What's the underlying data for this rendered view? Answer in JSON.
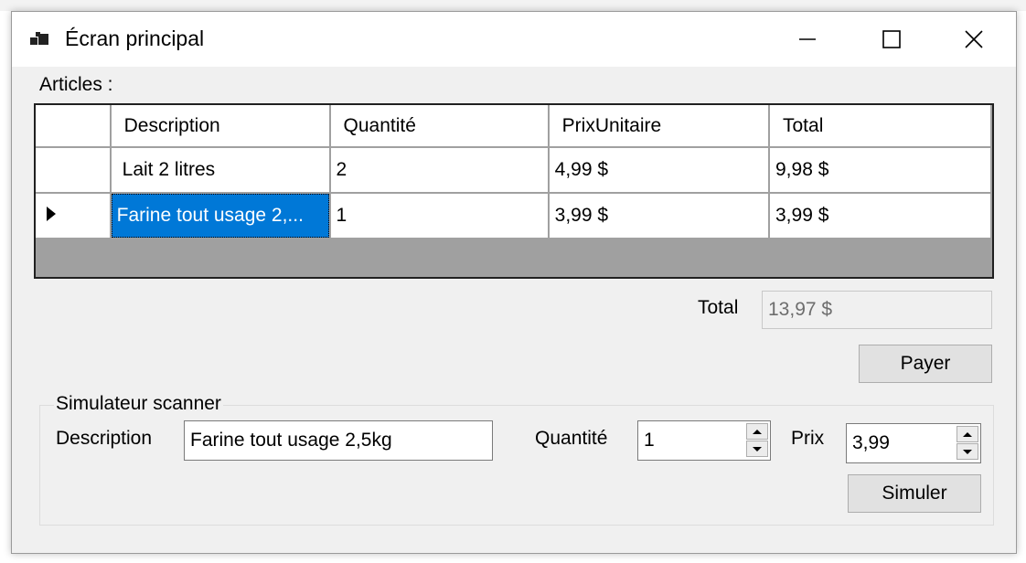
{
  "window": {
    "title": "Écran principal",
    "icons": {
      "app": "app-window-icon",
      "minimize": "minimize-icon",
      "maximize": "maximize-icon",
      "close": "close-icon"
    }
  },
  "articles": {
    "label": "Articles :",
    "columns": [
      "Description",
      "Quantité",
      "PrixUnitaire",
      "Total"
    ],
    "rows": [
      [
        "Lait 2 litres",
        "2",
        "4,99 $",
        "9,98 $"
      ],
      [
        "Farine tout usage 2,...",
        "1",
        "3,99 $",
        "3,99 $"
      ]
    ],
    "selected_row": 1,
    "row_indicator_icon": "row-pointer-icon"
  },
  "total": {
    "label": "Total",
    "value": "13,97 $"
  },
  "payer_button": "Payer",
  "scanner": {
    "title": "Simulateur scanner",
    "description_label": "Description",
    "description_value": "Farine tout usage 2,5kg",
    "quantity_label": "Quantité",
    "quantity_value": "1",
    "price_label": "Prix",
    "price_value": "3,99",
    "simulate_button": "Simuler"
  },
  "colors": {
    "selection": "#0078d7",
    "window_bg": "#f0f0f0",
    "grid_bg": "#a0a0a0"
  }
}
